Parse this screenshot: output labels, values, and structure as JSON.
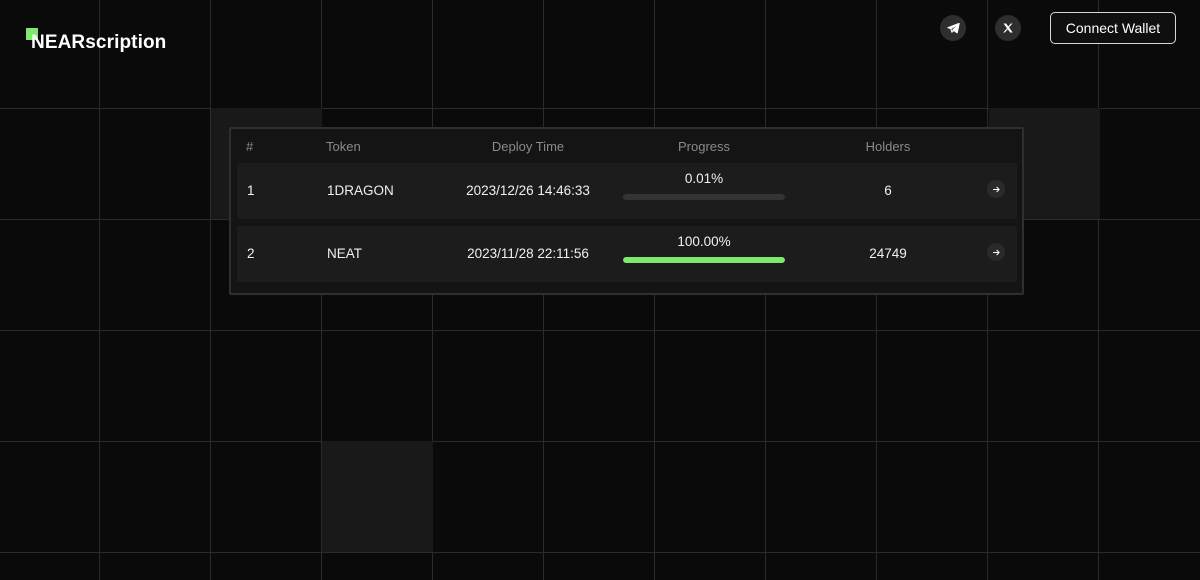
{
  "brand": {
    "name": "NEARscription",
    "accent_color": "#7ee86f"
  },
  "header": {
    "social": [
      {
        "icon": "telegram-icon"
      },
      {
        "icon": "x-icon"
      }
    ],
    "connect_label": "Connect Wallet"
  },
  "table": {
    "columns": {
      "num": "#",
      "token": "Token",
      "deploy": "Deploy Time",
      "progress": "Progress",
      "holders": "Holders"
    },
    "rows": [
      {
        "num": "1",
        "token": "1DRAGON",
        "deploy_time": "2023/12/26 14:46:33",
        "progress_label": "0.01%",
        "progress": 0.0001,
        "holders": "6"
      },
      {
        "num": "2",
        "token": "NEAT",
        "deploy_time": "2023/11/28 22:11:56",
        "progress_label": "100.00%",
        "progress": 1.0,
        "holders": "24749"
      }
    ]
  }
}
